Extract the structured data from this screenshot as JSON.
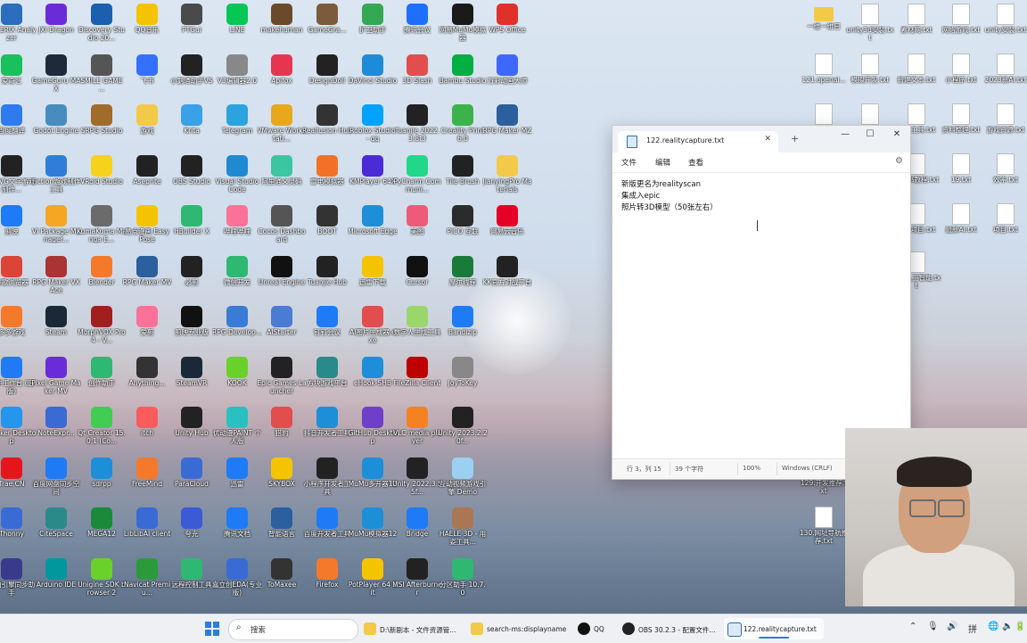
{
  "desktop": {
    "left_icons": [
      {
        "label": "ASTERIX Analyzer",
        "color": "#2a6ebd"
      },
      {
        "label": "JXI Dragon",
        "color": "#6a2cd8"
      },
      {
        "label": "Discovery Studio 20...",
        "color": "#1b5fae"
      },
      {
        "label": "QQ音乐",
        "color": "#f5c400"
      },
      {
        "label": "PTGui",
        "color": "#4a4a4a"
      },
      {
        "label": "LINE",
        "color": "#06c755"
      },
      {
        "label": "makehuman",
        "color": "#6b4a2b"
      },
      {
        "label": "GameGra...",
        "color": "#7a5c3c"
      },
      {
        "label": "护卫助手",
        "color": "#35a853"
      },
      {
        "label": "腾讯会议",
        "color": "#1e6fff"
      },
      {
        "label": "网易MuMu模拟器",
        "color": "#1a1a1a"
      },
      {
        "label": "WPS Office",
        "color": "#e0302a"
      },
      {
        "label": "爱奇艺",
        "color": "#19c15a"
      },
      {
        "label": "GameGuru MAX",
        "color": "#1e2a3a"
      },
      {
        "label": "SMILE GAME ...",
        "color": "#555"
      },
      {
        "label": "飞书",
        "color": "#3370ff"
      },
      {
        "label": "小鹅通助手VS",
        "color": "#222"
      },
      {
        "label": "V3编辑器2.0",
        "color": "#888"
      },
      {
        "label": "Apifox",
        "color": "#e6364f"
      },
      {
        "label": "DesignDoll",
        "color": "#222"
      },
      {
        "label": "DaVinci Studio",
        "color": "#1c8cd8"
      },
      {
        "label": "3D Slash",
        "color": "#e24d4d"
      },
      {
        "label": "Bambu Studio",
        "color": "#00ae42"
      },
      {
        "label": "万彩动画大师",
        "color": "#3d68ff"
      },
      {
        "label": "百度翻译",
        "color": "#2e7bf0"
      },
      {
        "label": "Godot Engine",
        "color": "#478cbf"
      },
      {
        "label": "SRPG Studio",
        "color": "#a06b2b"
      },
      {
        "label": "游戏",
        "color": "#f3c94a"
      },
      {
        "label": "Krita",
        "color": "#3aa0e8"
      },
      {
        "label": "Telegram",
        "color": "#2aa3de"
      },
      {
        "label": "VMware Workstati...",
        "color": "#e8a81e"
      },
      {
        "label": "Reallusion Hub",
        "color": "#333"
      },
      {
        "label": "Roblox Studio - qq",
        "color": "#00a2ff"
      },
      {
        "label": "Tuanjie 2022.3.8t3",
        "color": "#222"
      },
      {
        "label": "Creality Print 6.0",
        "color": "#3bb34a"
      },
      {
        "label": "RPG Maker MZ",
        "color": "#2b5f9e"
      },
      {
        "label": "N AVG文字游戏制作...",
        "color": "#222"
      },
      {
        "label": "Fiction游戏制作工具",
        "color": "#2f7dd6"
      },
      {
        "label": "VRoid Studio",
        "color": "#f7d21c"
      },
      {
        "label": "Aseprite",
        "color": "#222"
      },
      {
        "label": "OBS Studio",
        "color": "#222"
      },
      {
        "label": "Visual Studio Code",
        "color": "#1f8ad2"
      },
      {
        "label": "阿里通义灵码",
        "color": "#3bc6a0"
      },
      {
        "label": "雷电模拟器",
        "color": "#f27125"
      },
      {
        "label": "KMPlayer 64X",
        "color": "#4a2bd6"
      },
      {
        "label": "PyCharm Communi...",
        "color": "#21d789"
      },
      {
        "label": "Tile Brush",
        "color": "#222"
      },
      {
        "label": "JianyingPro Materials",
        "color": "#f3c94a"
      },
      {
        "label": "剪映",
        "color": "#1e7bf5"
      },
      {
        "label": "VI Package Manager...",
        "color": "#f5a623"
      },
      {
        "label": "KumaKuma Manga E...",
        "color": "#6b6b6b"
      },
      {
        "label": "易点漫画 Easy Pose",
        "color": "#f5c400"
      },
      {
        "label": "HBuilder X",
        "color": "#2eb872"
      },
      {
        "label": "哔哩哔哩",
        "color": "#fb7299"
      },
      {
        "label": "Cocos Dashboard",
        "color": "#555"
      },
      {
        "label": "BOOT",
        "color": "#333"
      },
      {
        "label": "Microsoft Edge",
        "color": "#1d8fd8"
      },
      {
        "label": "美图",
        "color": "#ee5a79"
      },
      {
        "label": "PICO 互联",
        "color": "#2b2b2b"
      },
      {
        "label": "网易云音乐",
        "color": "#e60026"
      },
      {
        "label": "谷歌浏览器",
        "color": "#db4437"
      },
      {
        "label": "RPG Maker VX Ace",
        "color": "#a33"
      },
      {
        "label": "Blender",
        "color": "#f5792a"
      },
      {
        "label": "RPG Maker MV",
        "color": "#2b5f9e"
      },
      {
        "label": "必剪",
        "color": "#222"
      },
      {
        "label": "微信开发",
        "color": "#2eb872"
      },
      {
        "label": "Unreal Engine",
        "color": "#111"
      },
      {
        "label": "Tuanjie Hub",
        "color": "#222"
      },
      {
        "label": "迅雷下载",
        "color": "#f5c400"
      },
      {
        "label": "Cursor",
        "color": "#111"
      },
      {
        "label": "摩尔线程",
        "color": "#1a7a3a"
      },
      {
        "label": "KK官方对战平台",
        "color": "#222"
      },
      {
        "label": "多多游戏",
        "color": "#f5792a"
      },
      {
        "label": "Steam",
        "color": "#1b2838"
      },
      {
        "label": "MorphVOX Pro 4 - V...",
        "color": "#a02020"
      },
      {
        "label": "爱剪",
        "color": "#fb7299"
      },
      {
        "label": "剪映专业版",
        "color": "#111"
      },
      {
        "label": "RPG Develop...",
        "color": "#3a7bd5"
      },
      {
        "label": "AIStarter",
        "color": "#4a7bd5"
      },
      {
        "label": "钉钉会议",
        "color": "#1e7bf5"
      },
      {
        "label": "AI图片生成器.exe",
        "color": "#e24d4d"
      },
      {
        "label": "数字人生成工具",
        "color": "#9bd66b"
      },
      {
        "label": "Bandizip",
        "color": "#1e7bf5"
      },
      {
        "label": "",
        "color": "transparent"
      },
      {
        "label": "千牛工作台 (旧版)",
        "color": "#1e7bf5"
      },
      {
        "label": "Pixel Game Maker MV",
        "color": "#6a2cd8"
      },
      {
        "label": "创作助手",
        "color": "#2eb872"
      },
      {
        "label": "Anything...",
        "color": "#333"
      },
      {
        "label": "SteamVR",
        "color": "#1b2838"
      },
      {
        "label": "KOOK",
        "color": "#6ad12a"
      },
      {
        "label": "Epic Games Launcher",
        "color": "#222"
      },
      {
        "label": "方块游戏平台",
        "color": "#2a8a8a"
      },
      {
        "label": "eHook-SHB",
        "color": "#1d8fd8"
      },
      {
        "label": "FileZilla Client",
        "color": "#bf0000"
      },
      {
        "label": "JoyToKey",
        "color": "#888"
      },
      {
        "label": "",
        "color": "transparent"
      },
      {
        "label": "Docker Desktop",
        "color": "#2496ed"
      },
      {
        "label": "NoteExpr...",
        "color": "#3a6bd5"
      },
      {
        "label": "Qt Creator 15.0.1 (Co...",
        "color": "#41cd52"
      },
      {
        "label": "itch",
        "color": "#fa5c5c"
      },
      {
        "label": "Unity Hub",
        "color": "#222"
      },
      {
        "label": "优动漫PAINT 个人版",
        "color": "#2ac0c0"
      },
      {
        "label": "猎豹",
        "color": "#e24d4d"
      },
      {
        "label": "抖音开发者工具",
        "color": "#1d8fd8"
      },
      {
        "label": "GitHub Desktop",
        "color": "#6e40c9"
      },
      {
        "label": "VLC media player",
        "color": "#f58220"
      },
      {
        "label": "Unity 2023.2.20f...",
        "color": "#222"
      },
      {
        "label": "",
        "color": "transparent"
      },
      {
        "label": "Trae CN",
        "color": "#e4161c"
      },
      {
        "label": "百度网盘同步空间",
        "color": "#1e7bf5"
      },
      {
        "label": "sdrpp",
        "color": "#1d8fd8"
      },
      {
        "label": "FreeMind",
        "color": "#f5792a"
      },
      {
        "label": "ParaCloud",
        "color": "#3a6bd5"
      },
      {
        "label": "迅雷",
        "color": "#1e7bf5"
      },
      {
        "label": "SKYBOX",
        "color": "#f5c400"
      },
      {
        "label": "小程序开发者工具",
        "color": "#222"
      },
      {
        "label": "MuMu多开器12",
        "color": "#1d8fd8"
      },
      {
        "label": "Unity 2022.3.55f...",
        "color": "#222"
      },
      {
        "label": "互动视频游戏引擎 Demo",
        "color": "#9bd0f0"
      },
      {
        "label": "",
        "color": "transparent"
      },
      {
        "label": "Thonny",
        "color": "#3a6bd5"
      },
      {
        "label": "CiteSpace",
        "color": "#2a8a8a"
      },
      {
        "label": "MEGA12",
        "color": "#1a8a3a"
      },
      {
        "label": "LibLibAI client",
        "color": "#3a6bd5"
      },
      {
        "label": "夸克",
        "color": "#3a5bd5"
      },
      {
        "label": "腾讯文档",
        "color": "#1e7bf5"
      },
      {
        "label": "智能语言",
        "color": "#2b5f9e"
      },
      {
        "label": "百度开发者工具",
        "color": "#1e7bf5"
      },
      {
        "label": "MuMu模拟器12",
        "color": "#1d8fd8"
      },
      {
        "label": "Bridge",
        "color": "#1e7bf5"
      },
      {
        "label": "HAELE 3D - 用姿工具...",
        "color": "#aa7755"
      },
      {
        "label": "",
        "color": "transparent"
      },
      {
        "label": "火山引擎同步助手",
        "color": "#3a3a8a"
      },
      {
        "label": "Arduino IDE",
        "color": "#00979d"
      },
      {
        "label": "Unigine SDK browser 2",
        "color": "#6ad12a"
      },
      {
        "label": "Navicat Premiu...",
        "color": "#2b9a3a"
      },
      {
        "label": "远程控制工具",
        "color": "#2eb872"
      },
      {
        "label": "嘉立创EDA(专业版)",
        "color": "#3a6bd5"
      },
      {
        "label": "ToMaxee",
        "color": "#333"
      },
      {
        "label": "Firefox",
        "color": "#f5792a"
      },
      {
        "label": "PotPlayer 64 bit",
        "color": "#f5c400"
      },
      {
        "label": "MSI Afterburner",
        "color": "#222"
      },
      {
        "label": "分区助手 10.7.0",
        "color": "#2eb872"
      },
      {
        "label": "",
        "color": "transparent"
      }
    ],
    "right_icons": [
      {
        "label": "一维一维日",
        "type": "folder"
      },
      {
        "label": "unity3d安装.txt",
        "type": "txt"
      },
      {
        "label": "素材网.txt",
        "type": "txt"
      },
      {
        "label": "网络游戏.txt",
        "type": "txt"
      },
      {
        "label": "unity安装.txt",
        "type": "txt"
      },
      {
        "label": "121.openai...",
        "type": "txt"
      },
      {
        "label": "模拟开发.txt",
        "type": "txt"
      },
      {
        "label": "新建文本.txt",
        "type": "txt"
      },
      {
        "label": "小程序.txt",
        "type": "txt"
      },
      {
        "label": "2023新AI.txt",
        "type": "txt"
      },
      {
        "label": "",
        "type": "txt"
      },
      {
        "label": "2024年新.txt",
        "type": "txt"
      },
      {
        "label": "下载工具.txt",
        "type": "txt"
      },
      {
        "label": "资料整理.txt",
        "type": "txt"
      },
      {
        "label": "游戏资源.txt",
        "type": "txt"
      },
      {
        "label": "tokenizer.txt",
        "type": "txt"
      },
      {
        "label": "新媒体.txt",
        "type": "txt"
      },
      {
        "label": "电子书教程.txt",
        "type": "txt"
      },
      {
        "label": "19.txt",
        "type": "txt"
      },
      {
        "label": "效率.txt",
        "type": "txt"
      },
      {
        "label": "blender使用快捷键.txt",
        "type": "txt"
      },
      {
        "label": "数据.txt",
        "type": "txt"
      },
      {
        "label": "日常项目.txt",
        "type": "txt"
      },
      {
        "label": "最新AI.txt",
        "type": "txt"
      },
      {
        "label": "项目.txt",
        "type": "txt"
      },
      {
        "label": "草稿人工智能.txt",
        "type": "txt"
      },
      {
        "label": "129.开发推荐.txt",
        "type": "txt"
      },
      {
        "label": "130.网址导航推荐.txt",
        "type": "txt"
      }
    ]
  },
  "notepad": {
    "tab_title": "122.realitycapture.txt",
    "tab_close": "✕",
    "new_tab": "+",
    "win_min": "—",
    "win_max": "☐",
    "win_close": "✕",
    "menu": {
      "file": "文件",
      "edit": "编辑",
      "view": "查看"
    },
    "lines": [
      "新版更名为realityscan",
      "集成入epic",
      "照片转3D模型（50张左右）"
    ],
    "status": {
      "position": "行 3，列 15",
      "chars": "39 个字符",
      "zoom": "100%",
      "encoding": "Windows (CRLF)"
    }
  },
  "taskbar": {
    "search_placeholder": "搜索",
    "items": [
      {
        "label": "D:\\新剧本 - 文件资源管...",
        "color": "#f3c94a"
      },
      {
        "label": "search-ms:displayname",
        "color": "#f3c94a"
      },
      {
        "label": "QQ",
        "color": "#111"
      },
      {
        "label": "OBS 30.2.3 - 配置文件...",
        "color": "#222"
      },
      {
        "label": "122.realitycapture.txt",
        "color": "#2b6cb0"
      }
    ],
    "tray": {
      "chevron": "⌃",
      "mic": "🎙",
      "volume": "🔊",
      "ime": "拼",
      "wifi": "🌐",
      "sound": "🔈",
      "battery": "🔋"
    }
  }
}
